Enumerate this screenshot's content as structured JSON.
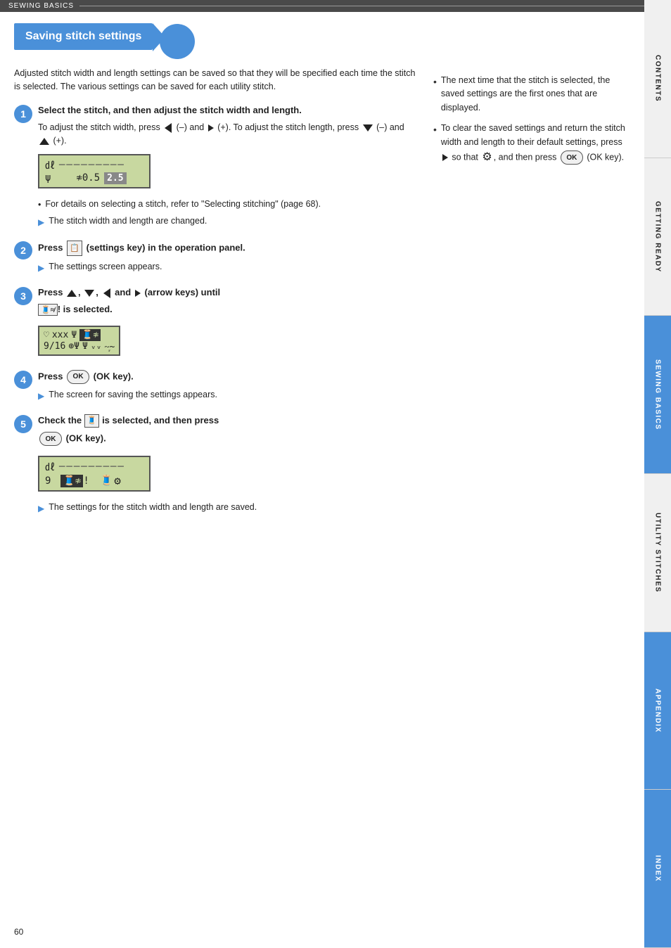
{
  "topbar": {
    "label": "SEWING BASICS"
  },
  "sidebar": {
    "sections": [
      {
        "id": "contents",
        "label": "CONTENTS",
        "active": false
      },
      {
        "id": "getting-ready",
        "label": "GETTING READY",
        "active": false
      },
      {
        "id": "sewing-basics",
        "label": "SEWING BASICS",
        "active": true
      },
      {
        "id": "utility-stitches",
        "label": "UTILITY STITCHES",
        "active": false
      },
      {
        "id": "appendix",
        "label": "APPENDIX",
        "active": true
      },
      {
        "id": "index",
        "label": "INDEX",
        "active": true
      }
    ]
  },
  "page": {
    "title": "Saving stitch settings",
    "intro": "Adjusted stitch width and length settings can be saved so that they will be specified each time the stitch is selected. The various settings can be saved for each utility stitch.",
    "steps": [
      {
        "number": "1",
        "title": "Select the stitch, and then adjust the stitch width and length.",
        "body": "To adjust the stitch width, press ◄ (–) and ► (+). To adjust the stitch length, press ▼ (–) and ▲ (+).",
        "sub_items": [
          {
            "type": "bullet",
            "text": "For details on selecting a stitch, refer to \"Selecting stitching\" (page 68)."
          },
          {
            "type": "arrow",
            "text": "The stitch width and length are changed."
          }
        ]
      },
      {
        "number": "2",
        "title": "Press  (settings key) in the operation panel.",
        "sub_items": [
          {
            "type": "arrow",
            "text": "The settings screen appears."
          }
        ]
      },
      {
        "number": "3",
        "title": "Press ▲, ▼, ◄ and ► (arrow keys) until  is selected.",
        "sub_items": []
      },
      {
        "number": "4",
        "title": "Press  (OK key).",
        "sub_items": [
          {
            "type": "arrow",
            "text": "The screen for saving the settings appears."
          }
        ]
      },
      {
        "number": "5",
        "title": "Check the  is selected, and then press  (OK key).",
        "sub_items": [
          {
            "type": "arrow",
            "text": "The settings for the stitch width and length are saved."
          }
        ]
      }
    ],
    "right_col": [
      {
        "text": "The next time that the stitch is selected, the saved settings are the first ones that are displayed."
      },
      {
        "text": "To clear the saved settings and return the stitch width and length to their default settings, press ► so that ⚙, and then press  (OK key)."
      }
    ],
    "page_number": "60"
  }
}
